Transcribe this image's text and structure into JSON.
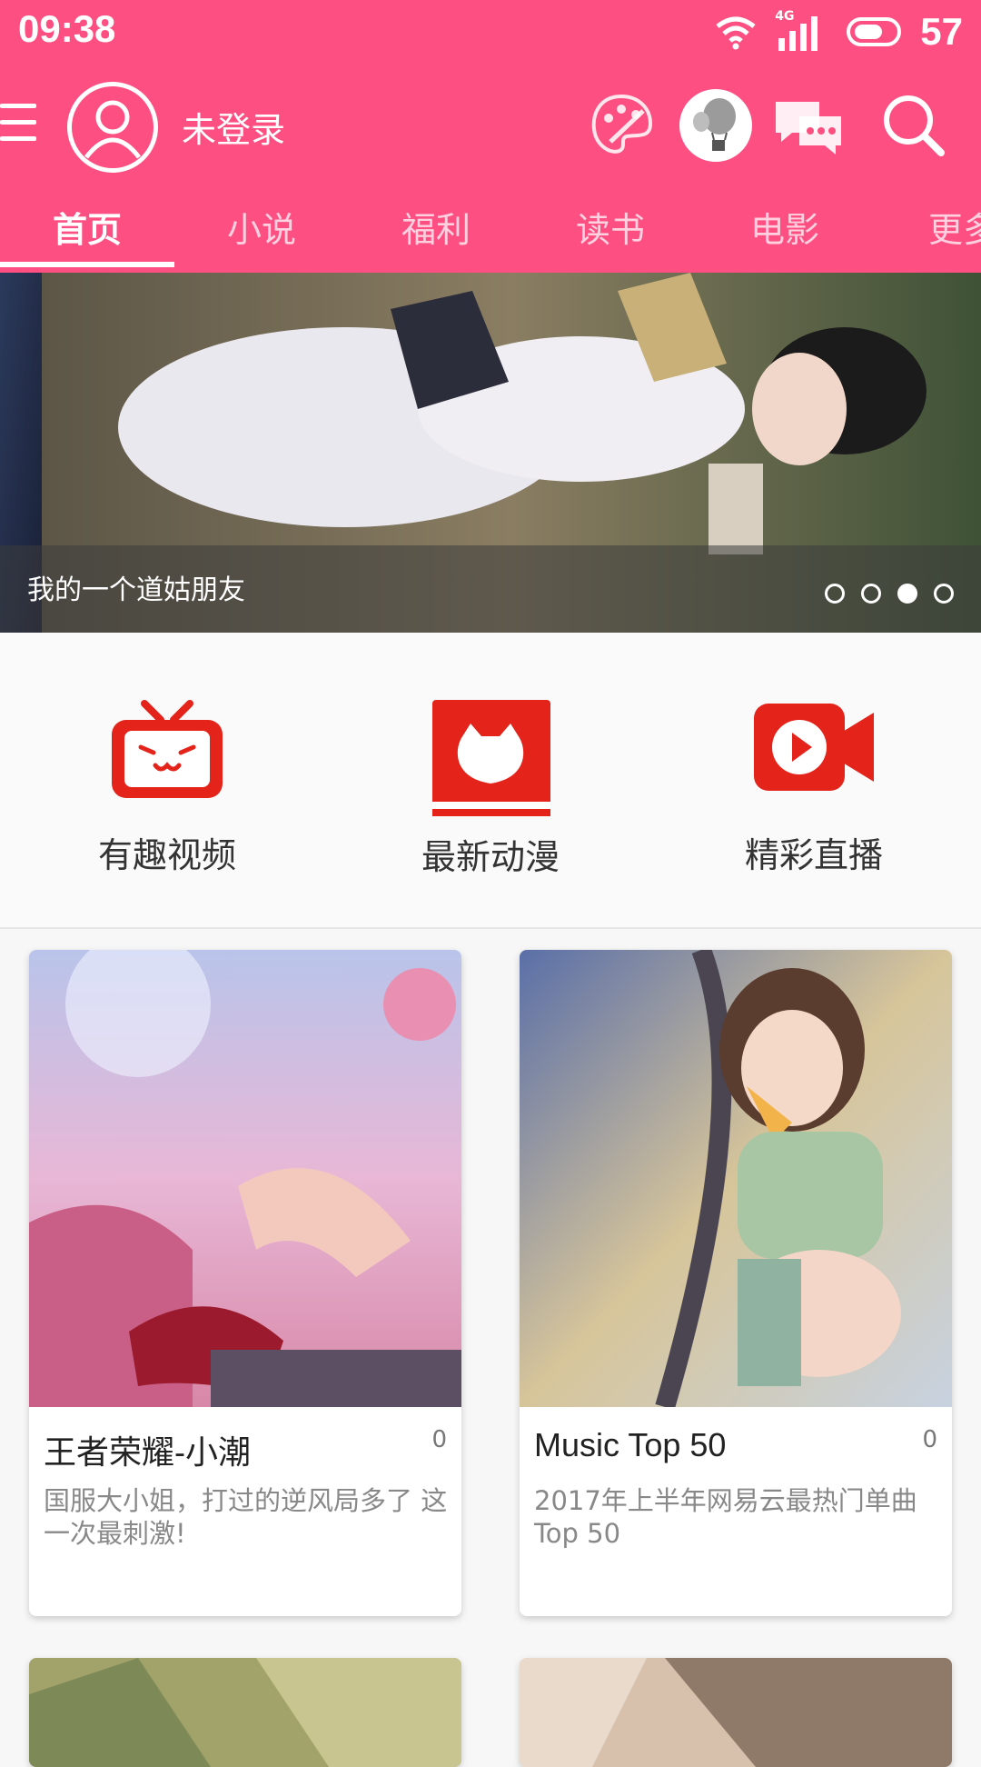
{
  "status_bar": {
    "time": "09:38",
    "network": "4G",
    "battery": "57",
    "icons": [
      "wifi-icon",
      "signal-icon",
      "battery-icon"
    ]
  },
  "app_bar": {
    "username": "未登录",
    "icons": [
      "menu-icon",
      "avatar-icon",
      "palette-icon",
      "balloon-icon",
      "chat-icon",
      "search-icon"
    ]
  },
  "tabs": [
    {
      "label": "首页",
      "active": true
    },
    {
      "label": "小说"
    },
    {
      "label": "福利"
    },
    {
      "label": "读书"
    },
    {
      "label": "电影"
    },
    {
      "label": "更多"
    }
  ],
  "banner": {
    "caption": "我的一个道姑朋友",
    "dots_total": 4,
    "active_dot_index": 2
  },
  "quick_menu": [
    {
      "label": "有趣视频",
      "icon": "tv-icon"
    },
    {
      "label": "最新动漫",
      "icon": "cat-book-icon"
    },
    {
      "label": "精彩直播",
      "icon": "video-camera-icon"
    }
  ],
  "cards": [
    {
      "title": "王者荣耀-小潮",
      "count": "0",
      "desc": "国服大小姐，打过的逆风局多了 这一次最刺激!"
    },
    {
      "title": "Music Top 50",
      "count": "0",
      "desc": "2017年上半年网易云最热门单曲Top 50"
    }
  ],
  "colors": {
    "accent": "#fd4f82",
    "icon_red": "#e4241b"
  }
}
